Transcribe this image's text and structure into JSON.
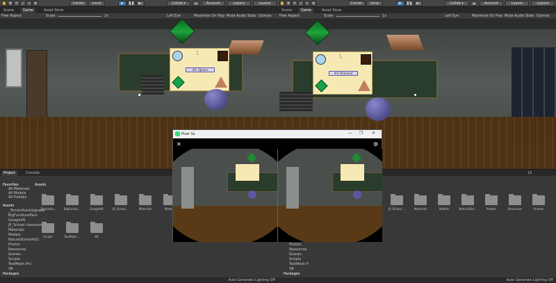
{
  "left": {
    "toolbar": {
      "center": "Center",
      "local": "Local",
      "collab": "Collab ▾",
      "account": "Account",
      "layers": "Layers",
      "layout": "Layout"
    },
    "tabs": [
      "Scene",
      "Game",
      "Asset Store"
    ],
    "gamebar": {
      "aspect": "Free Aspect",
      "scale_label": "Scale",
      "scale_value": "1x",
      "eye": "Left Eye",
      "maximize": "Maximize On Play",
      "mute": "Mute Audio",
      "stats": "Stats",
      "gizmos": "Gizmos"
    },
    "card": {
      "number": "1",
      "label": "#2: Sphere"
    },
    "project_tabs": [
      "Project",
      "Console"
    ],
    "favorites": {
      "header": "Favorites",
      "items": [
        "All Materials",
        "All Models",
        "All Prefabs"
      ]
    },
    "assets_tree": {
      "header": "Assets",
      "items": [
        "_TerrainAutoUpgrade",
        "BigFurniturePack",
        "GoogleVR",
        "JP_School classroom",
        "Materials",
        "Models",
        "NatureStarterKit2",
        "Photon",
        "Resources",
        "Scenes",
        "Scripts",
        "TextMesh Pro",
        "XR"
      ]
    },
    "packages": "Packages",
    "assets_label": "Assets",
    "folders": [
      "_TerrainAu...",
      "BigFurnitu...",
      "GoogleVR",
      "JP_School ...",
      "Materials",
      "Models",
      "Scripts",
      "TextMesh ...",
      "XR"
    ]
  },
  "right": {
    "toolbar": {
      "center": "Center",
      "local": "Local",
      "collab": "Collab ▾",
      "account": "Account",
      "layers": "Layers",
      "layout": "Layout"
    },
    "tabs": [
      "Scene",
      "Game",
      "Asset Store"
    ],
    "gamebar": {
      "aspect": "Free Aspect",
      "scale_label": "Scale",
      "scale_value": "1x",
      "eye": "Left Eye",
      "maximize": "Maximize On Play",
      "mute": "Mute Audio",
      "stats": "Stats",
      "gizmos": "Gizmos"
    },
    "card": {
      "number": "1",
      "label": "#3: Diamond"
    },
    "count": "10",
    "folders": [
      "JP_School ...",
      "Materials",
      "Models",
      "NatureStar...",
      "Photon",
      "Resources",
      "Scenes"
    ],
    "tree": [
      "Photon",
      "Resources",
      "Scenes",
      "Scripts",
      "TextMesh P",
      "XR"
    ],
    "packages": "Packages"
  },
  "status": "Auto Generate Lighting Off",
  "phone": {
    "title": "Pixel 3a",
    "close": "✕",
    "settings": "⚙",
    "restore": "❐",
    "minimize": "—",
    "window_close": "✕"
  },
  "colors": {
    "accent_play": "#3a72b0",
    "card": "#f7e9b4",
    "floor": "#5e3c18"
  }
}
